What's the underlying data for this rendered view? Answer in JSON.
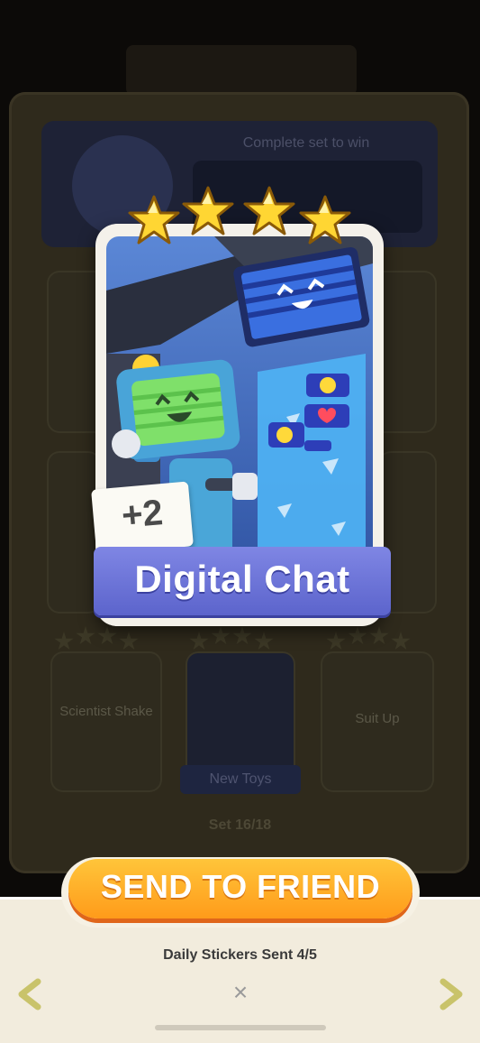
{
  "background": {
    "complete_text": "Complete set to win",
    "set_progress": "Set 16/18",
    "new_toys_label": "New Toys",
    "card_labels": [
      "Scientist Shake",
      "Suit Up"
    ]
  },
  "sticker": {
    "name": "Digital Chat",
    "bonus": "+2",
    "stars": 4,
    "star_color": "#ffd633",
    "banner_color": "#6b72d8"
  },
  "actions": {
    "send_label": "SEND TO FRIEND",
    "daily_sent": "Daily Stickers Sent 4/5",
    "close_label": "×"
  },
  "icons": {
    "prev": "chevron-left-icon",
    "next": "chevron-right-icon",
    "close": "close-icon"
  }
}
